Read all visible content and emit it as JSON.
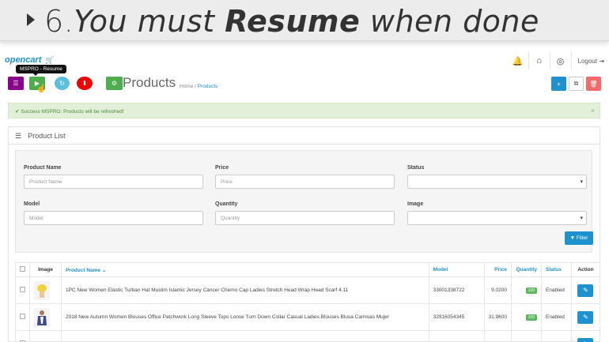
{
  "banner": {
    "number": "6.",
    "before": "You must ",
    "bold": "Resume",
    "after": " when done"
  },
  "header": {
    "logo": "opencart",
    "logout": "Logout"
  },
  "tooltip": "MSPRO - Resume",
  "page": {
    "title": "Products",
    "breadcrumb_home": "Home",
    "breadcrumb_sep": "/",
    "breadcrumb_current": "Products"
  },
  "alert": {
    "text": "Success MSPRO: Products will be refreshed!",
    "close": "×"
  },
  "panel": {
    "title": "Product List"
  },
  "filter": {
    "product_name_label": "Product Name",
    "product_name_placeholder": "Product Name",
    "price_label": "Price",
    "price_placeholder": "Price",
    "status_label": "Status",
    "status_value": "",
    "model_label": "Model",
    "model_placeholder": "Model",
    "quantity_label": "Quantity",
    "quantity_placeholder": "Quantity",
    "image_label": "Image",
    "image_value": "",
    "button": "Filter"
  },
  "table": {
    "headers": {
      "image": "Image",
      "product_name": "Product Name",
      "model": "Model",
      "price": "Price",
      "quantity": "Quantity",
      "status": "Status",
      "action": "Action"
    },
    "rows": [
      {
        "name": "1PC New Women Elastic Turban Hat Muslim Islamic Jersey Cancer Chemo Cap Ladies Stretch Head Wrap Head Scarf 4.11",
        "model": "33001338722",
        "price": "9.0200",
        "quantity": "100",
        "status": "Enabled"
      },
      {
        "name": "2018 New Autumn Women Blouses Office Patchwork Long Sleeve Tops Loose Turn Down Collar Casual Ladies Blouses Blusa Camisas Mujer",
        "model": "32916054345",
        "price": "31.9600",
        "quantity": "100",
        "status": "Enabled"
      }
    ]
  },
  "colors": {
    "primary": "#1e91cf",
    "success": "#4cae4c",
    "danger": "#e00000",
    "purple": "#8b008b",
    "alert_bg": "#e2f0d9"
  }
}
